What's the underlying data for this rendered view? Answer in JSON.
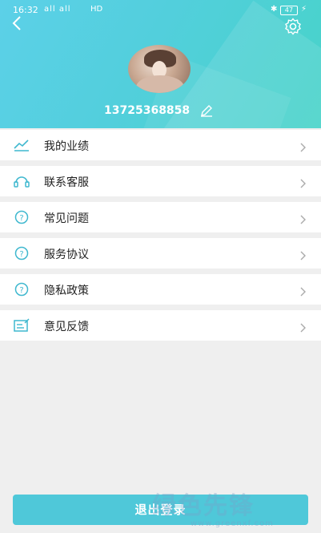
{
  "status_bar": {
    "time": "16:32",
    "signal": "all all",
    "network": "HD",
    "battery": "47"
  },
  "profile": {
    "username": "13725368858"
  },
  "menu": {
    "items": [
      {
        "label": "我的业绩",
        "icon": "trend-icon"
      },
      {
        "label": "联系客服",
        "icon": "headset-icon"
      },
      {
        "label": "常见问题",
        "icon": "question-icon"
      },
      {
        "label": "服务协议",
        "icon": "question-icon"
      },
      {
        "label": "隐私政策",
        "icon": "question-icon"
      },
      {
        "label": "意见反馈",
        "icon": "feedback-icon"
      }
    ]
  },
  "logout": {
    "label": "退出登录"
  },
  "watermark": {
    "text": "绿色先锋",
    "sub": "www.greenxf.com"
  },
  "colors": {
    "accent": "#4fc8d9",
    "header_start": "#5cd0e8",
    "header_end": "#47d3c8"
  }
}
